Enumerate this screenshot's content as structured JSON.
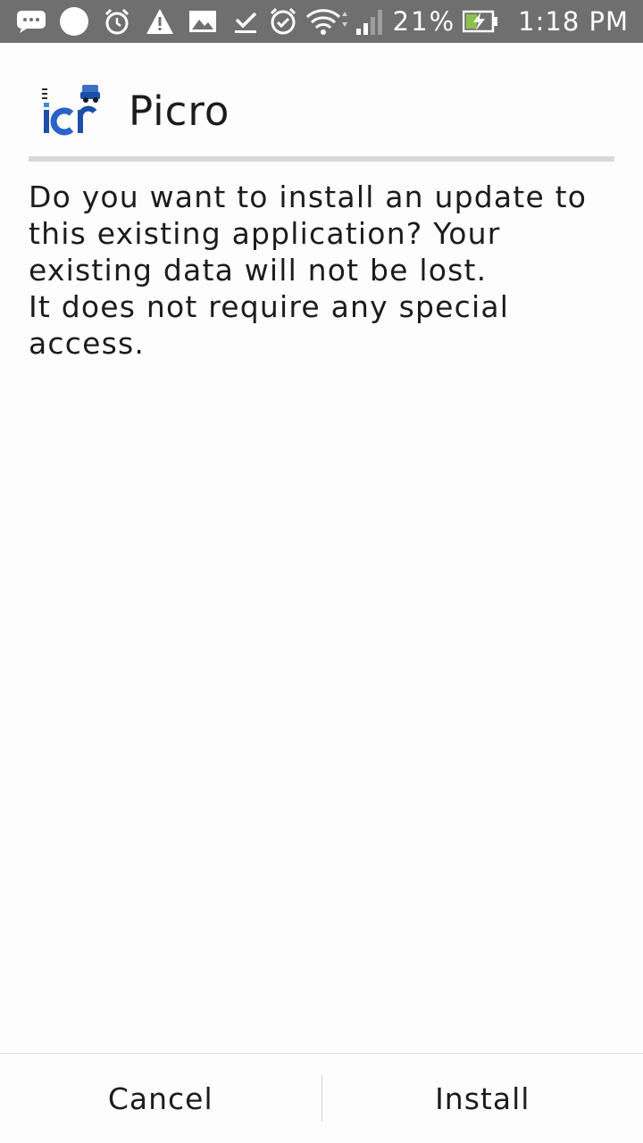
{
  "status_bar": {
    "left_icons": [
      "message-icon",
      "circle-icon",
      "alarm-icon",
      "warning-icon",
      "photo-icon",
      "download-done-icon"
    ],
    "right_icons": [
      "alarm-check-icon",
      "wifi-icon",
      "signal-icon",
      "battery-charging-icon"
    ],
    "battery_percent": "21%",
    "time": "1:18 PM"
  },
  "header": {
    "app_icon": "picro-app-icon",
    "app_name": "Picro"
  },
  "message": {
    "line1": "Do you want to install an update to this existing application? Your existing data will not be lost.",
    "line2": "It does not require any special access."
  },
  "buttons": {
    "cancel": "Cancel",
    "install": "Install"
  },
  "colors": {
    "status_bar_bg": "#6f6f6f",
    "background": "#fdfdfd",
    "divider": "#d9d9d9",
    "battery_charge": "#8bc34a",
    "logo_blue": "#1e4fa8"
  }
}
